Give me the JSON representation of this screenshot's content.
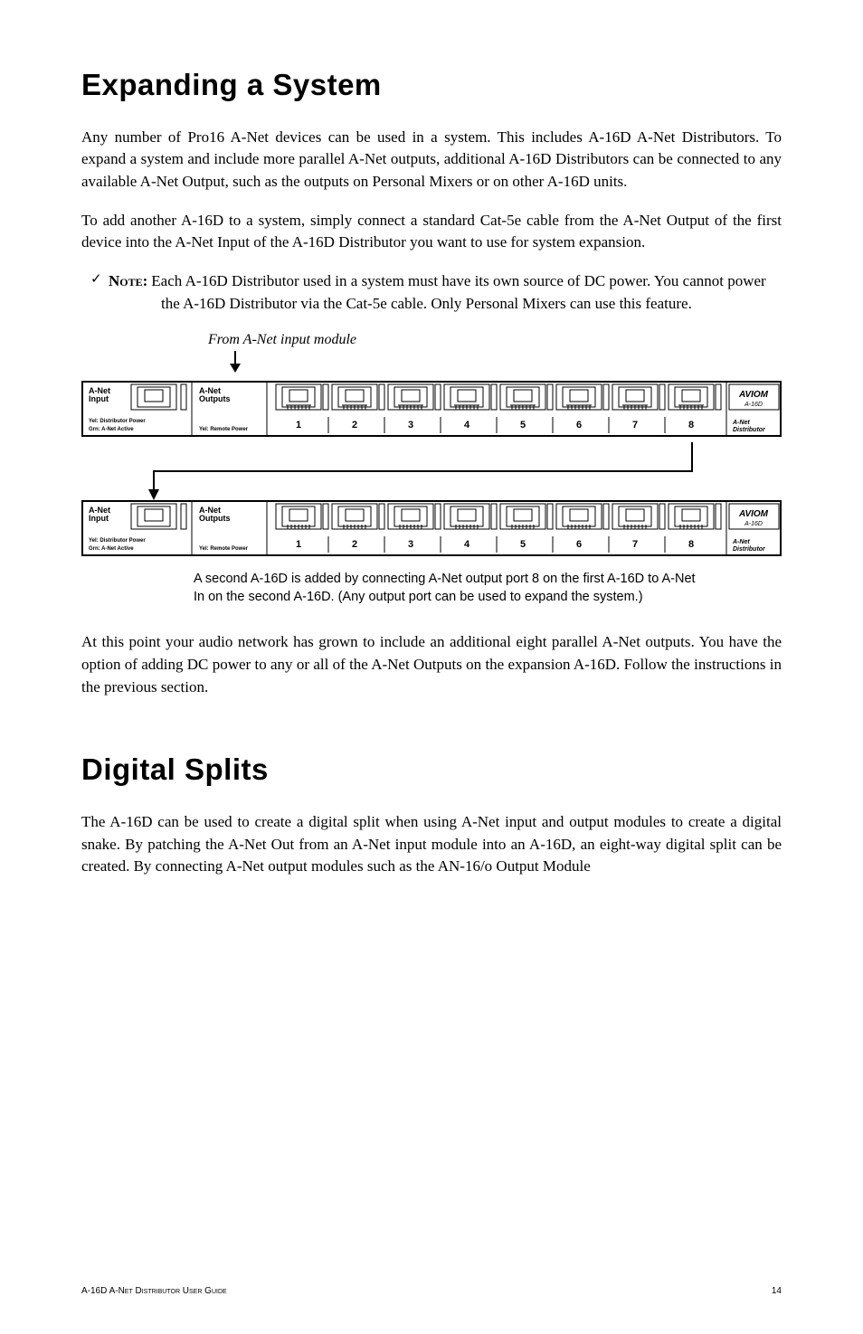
{
  "heading_expand": "Expanding a System",
  "p1": "Any number of Pro16 A-Net devices can be used in a system. This includes A-16D A-Net Distributors. To expand a system and include more parallel A-Net outputs, additional A-16D Distributors can be connected to any available A-Net Output, such as the outputs on Personal Mixers or on other A-16D units.",
  "p2": "To add another A-16D to a system, simply connect a standard Cat-5e cable from the A-Net Output of the first device into the A-Net Input of the A-16D Distributor you want to use for system expansion.",
  "note": {
    "check": "✓",
    "label": "Note:",
    "text": "Each A-16D Distributor used in a system must have its own source of DC power. You cannot power the A-16D Distributor via the Cat-5e cable. Only Personal Mixers can use this feature."
  },
  "diagram": {
    "top_caption": "From A-Net input module",
    "unit": {
      "input_label1": "A-Net",
      "input_label2": "Input",
      "output_label1": "A-Net",
      "output_label2": "Outputs",
      "dist_power": "Yel: Distributor Power",
      "active": "Grn: A-Net Active",
      "remote": "Yel: Remote Power",
      "ports": [
        "1",
        "2",
        "3",
        "4",
        "5",
        "6",
        "7",
        "8"
      ],
      "brand": "AVIOM",
      "model": "A-16D",
      "distributor1": "A-Net",
      "distributor2": "Distributor"
    },
    "caption": "A second A-16D is added by connecting A-Net output port 8 on the first A-16D to A-Net In on the second A-16D. (Any output port can be used to expand the system.)"
  },
  "p3": "At this point your audio network has grown to include an additional eight parallel A-Net outputs. You have the option of adding DC power to any or all of the A-Net Outputs on the expansion A-16D. Follow the instructions in the previous section.",
  "heading_splits": "Digital Splits",
  "p4": "The A-16D can be used to create a digital split when using A-Net input and output modules to create a digital snake. By patching the A-Net Out from an A-Net input module into an A-16D, an eight-way digital split can be created. By connecting A-Net output modules such as the AN-16/o Output Module",
  "footer": {
    "left": "A-16D A-Net Distributor User Guide",
    "right": "14"
  }
}
